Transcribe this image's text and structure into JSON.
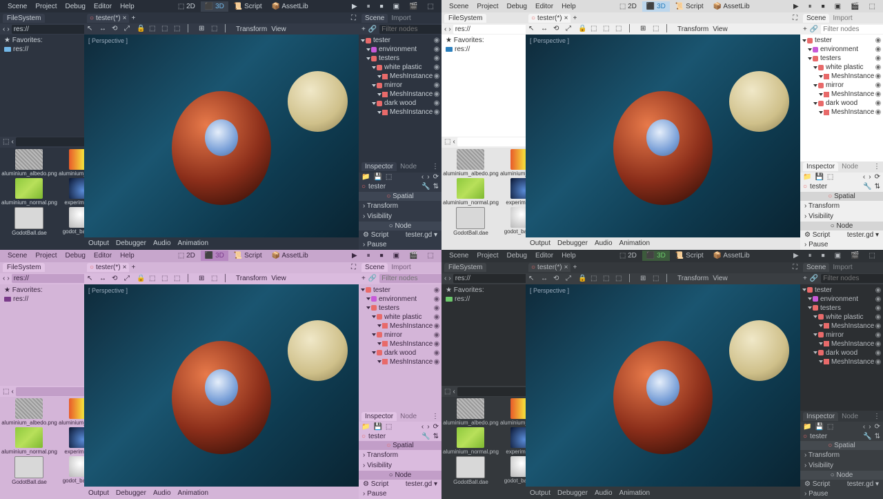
{
  "menu": {
    "scene": "Scene",
    "project": "Project",
    "debug": "Debug",
    "editor": "Editor",
    "help": "Help",
    "m2d": "2D",
    "m3d": "3D",
    "script": "Script",
    "assetlib": "AssetLib"
  },
  "docks": {
    "filesystem": "FileSystem",
    "scene": "Scene",
    "import": "Import",
    "inspector": "Inspector",
    "node": "Node"
  },
  "fs": {
    "path": "res://",
    "favorites": "Favorites:",
    "res": "res://",
    "files": [
      {
        "name": "aluminium_albedo.png",
        "thumb": "th-alum"
      },
      {
        "name": "aluminium_flow.png",
        "thumb": "th-flow"
      },
      {
        "name": "aluminium_normal.png",
        "thumb": "th-norm"
      },
      {
        "name": "experiment.hdr",
        "thumb": "th-exp"
      },
      {
        "name": "GodotBall.dae",
        "thumb": "th-dae"
      },
      {
        "name": "godot_ball.mesh",
        "thumb": "th-mesh"
      }
    ]
  },
  "tabs": {
    "file": "tester(*)"
  },
  "toolbar": {
    "transform": "Transform",
    "view": "View",
    "perspective": "[ Perspective ]"
  },
  "scene": {
    "filter": "Filter nodes",
    "tree": [
      {
        "name": "tester",
        "ico": "#e86a6a",
        "depth": 0
      },
      {
        "name": "environment",
        "ico": "#c85ad8",
        "depth": 1
      },
      {
        "name": "testers",
        "ico": "#e86a6a",
        "depth": 1
      },
      {
        "name": "white plastic",
        "ico": "#e86a6a",
        "depth": 2
      },
      {
        "name": "MeshInstance",
        "ico": "#e86a6a",
        "depth": 3,
        "mesh": true
      },
      {
        "name": "mirror",
        "ico": "#e86a6a",
        "depth": 2
      },
      {
        "name": "MeshInstance",
        "ico": "#e86a6a",
        "depth": 3,
        "mesh": true
      },
      {
        "name": "dark wood",
        "ico": "#e86a6a",
        "depth": 2
      },
      {
        "name": "MeshInstance",
        "ico": "#e86a6a",
        "depth": 3,
        "mesh": true
      }
    ]
  },
  "inspector": {
    "obj": "tester",
    "spatial": "Spatial",
    "transform": "Transform",
    "visibility": "Visibility",
    "node": "Node",
    "script": "Script",
    "script_val": "tester.gd",
    "pause": "Pause"
  },
  "bottom": {
    "output": "Output",
    "debugger": "Debugger",
    "audio": "Audio",
    "animation": "Animation"
  },
  "themes": [
    "t-default",
    "t-light",
    "t-alien",
    "t-grey"
  ]
}
